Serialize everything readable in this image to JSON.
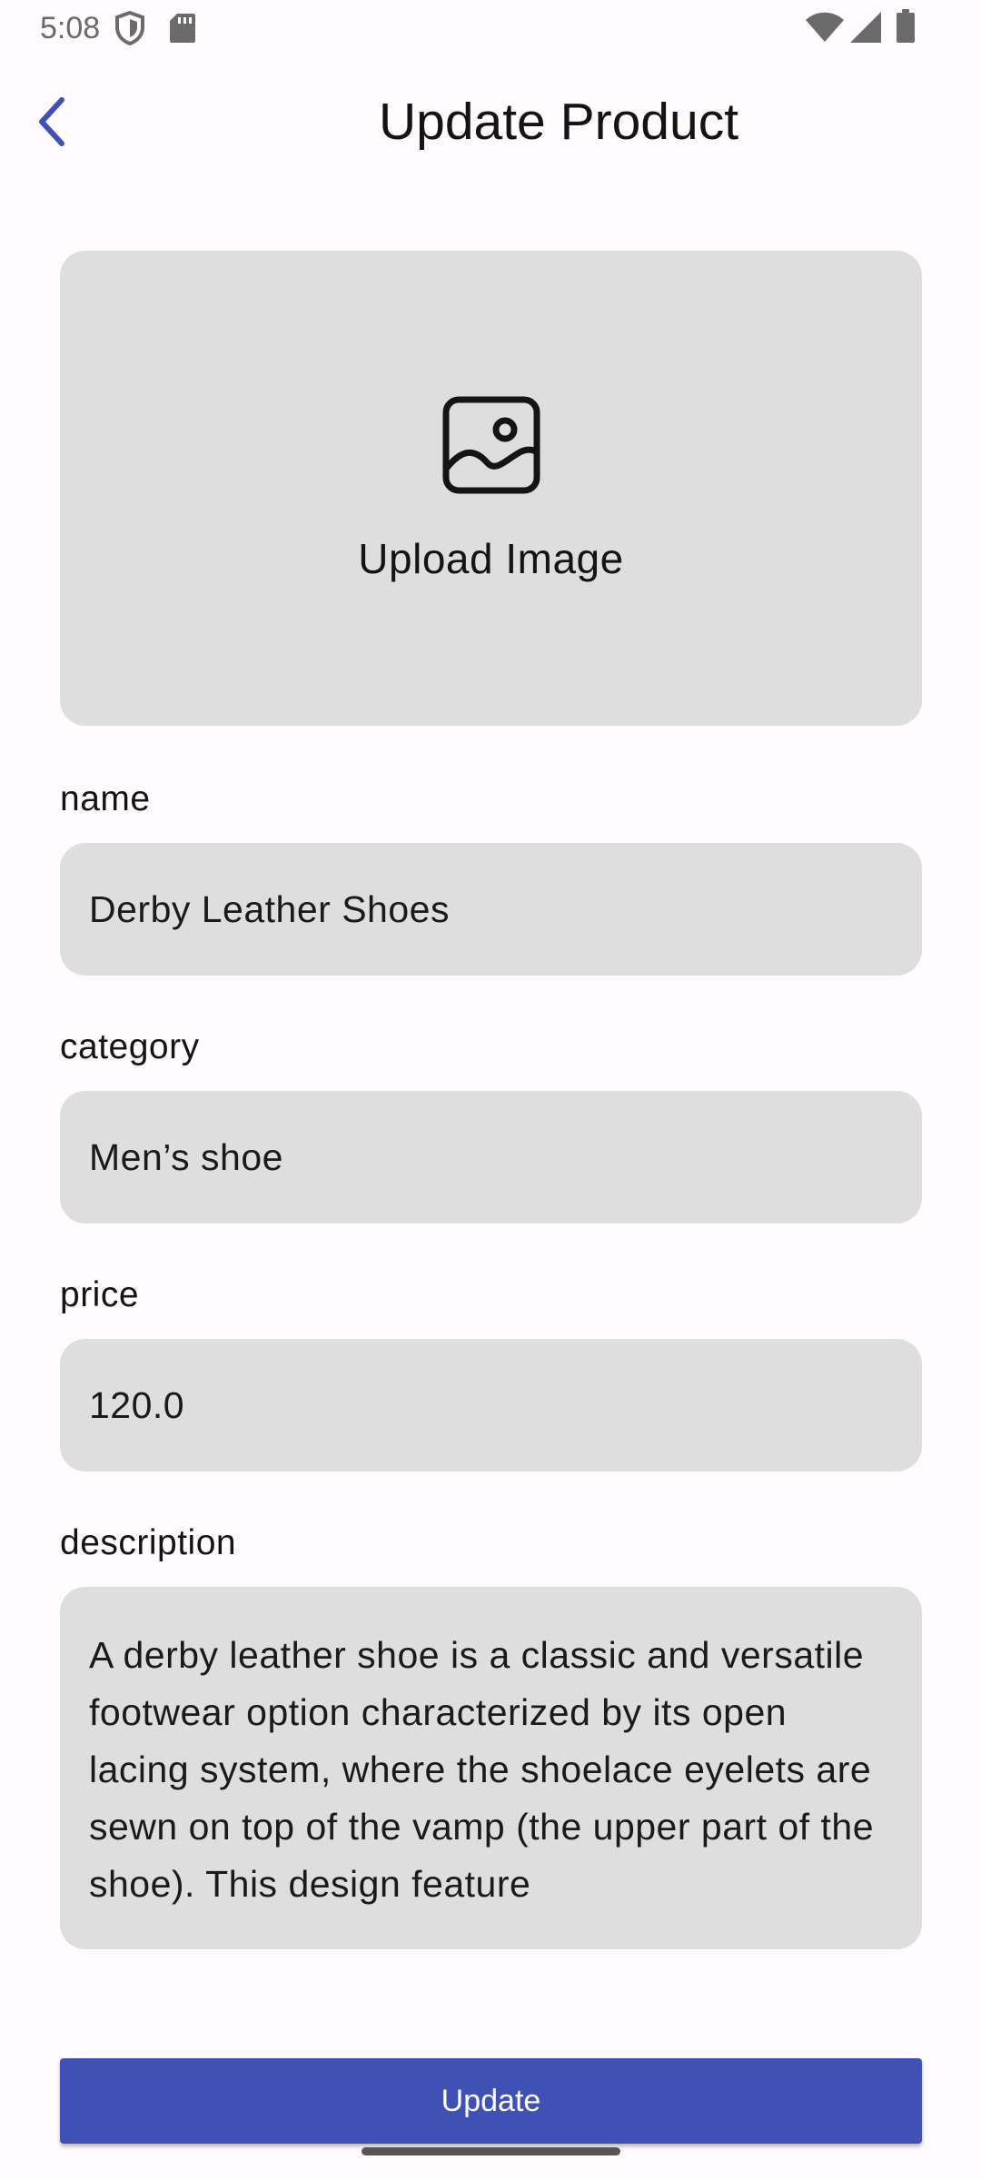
{
  "status_bar": {
    "time": "5:08",
    "icons": [
      "shield-icon",
      "sd-card-icon",
      "wifi-icon",
      "cellular-signal-icon",
      "battery-icon"
    ]
  },
  "app_bar": {
    "back_icon": "chevron-left-icon",
    "title": "Update Product",
    "accent_color": "#3F51B5"
  },
  "image_upload": {
    "icon": "image-icon",
    "label": "Upload Image"
  },
  "fields": {
    "name": {
      "label": "name",
      "value": "Derby Leather Shoes"
    },
    "category": {
      "label": "category",
      "value": "Men’s shoe"
    },
    "price": {
      "label": "price",
      "value": "120.0"
    },
    "description": {
      "label": "description",
      "value": "A derby leather shoe is a classic and versatile footwear option characterized by its open lacing system, where the shoelace eyelets are sewn on top of the vamp (the upper part of the shoe). This design feature"
    }
  },
  "actions": {
    "update_label": "Update",
    "button_color": "#3F51B5"
  }
}
